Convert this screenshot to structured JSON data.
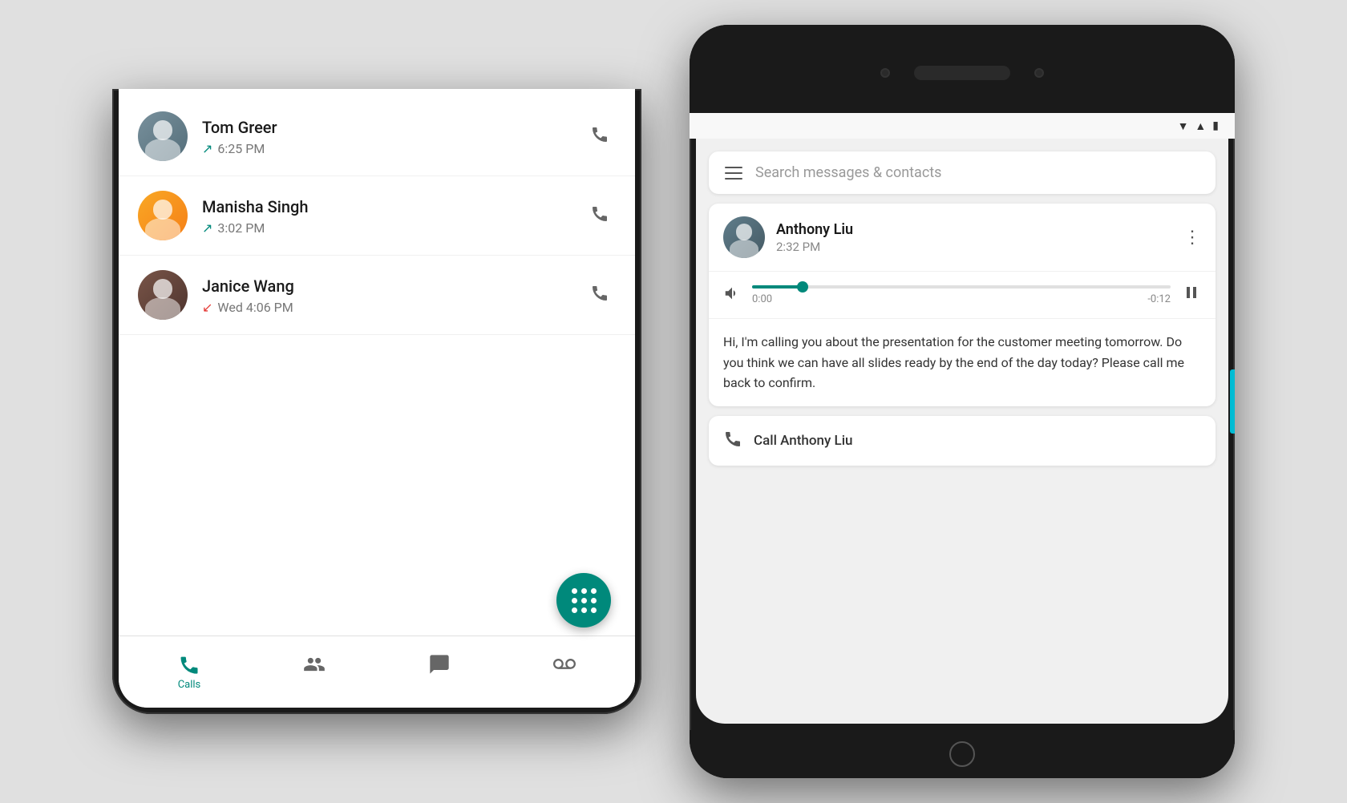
{
  "left_phone": {
    "contacts": [
      {
        "id": "tom-greer",
        "name": "Tom Greer",
        "call_type": "outgoing",
        "time": "6:25 PM",
        "arrow": "↗"
      },
      {
        "id": "manisha-singh",
        "name": "Manisha Singh",
        "call_type": "outgoing",
        "time": "3:02 PM",
        "arrow": "↗"
      },
      {
        "id": "janice-wang",
        "name": "Janice Wang",
        "call_type": "missed",
        "time": "Wed 4:06 PM",
        "arrow": "↙"
      }
    ],
    "nav": {
      "items": [
        {
          "id": "calls",
          "label": "Calls",
          "active": true,
          "icon": "📞"
        },
        {
          "id": "contacts",
          "label": "Contacts",
          "active": false,
          "icon": "👥"
        },
        {
          "id": "messages",
          "label": "Messages",
          "active": false,
          "icon": "💬"
        },
        {
          "id": "voicemail",
          "label": "Voicemail",
          "active": false,
          "icon": "📟"
        }
      ]
    }
  },
  "right_phone": {
    "search_placeholder": "Search messages & contacts",
    "message": {
      "sender_name": "Anthony Liu",
      "sender_time": "2:32 PM",
      "audio_start": "0:00",
      "audio_end": "-0:12",
      "progress_percent": 12,
      "transcript": "Hi, I'm calling you about the presentation for the customer meeting tomorrow. Do you think we can have all slides ready by the end of the day today? Please call me back to confirm.",
      "call_action_label": "Call Anthony Liu"
    }
  },
  "colors": {
    "teal": "#00897b",
    "teal_light": "#00bcd4",
    "missed_red": "#e53935",
    "nav_active": "#00897b",
    "text_dark": "#1a1a1a",
    "text_gray": "#777"
  }
}
